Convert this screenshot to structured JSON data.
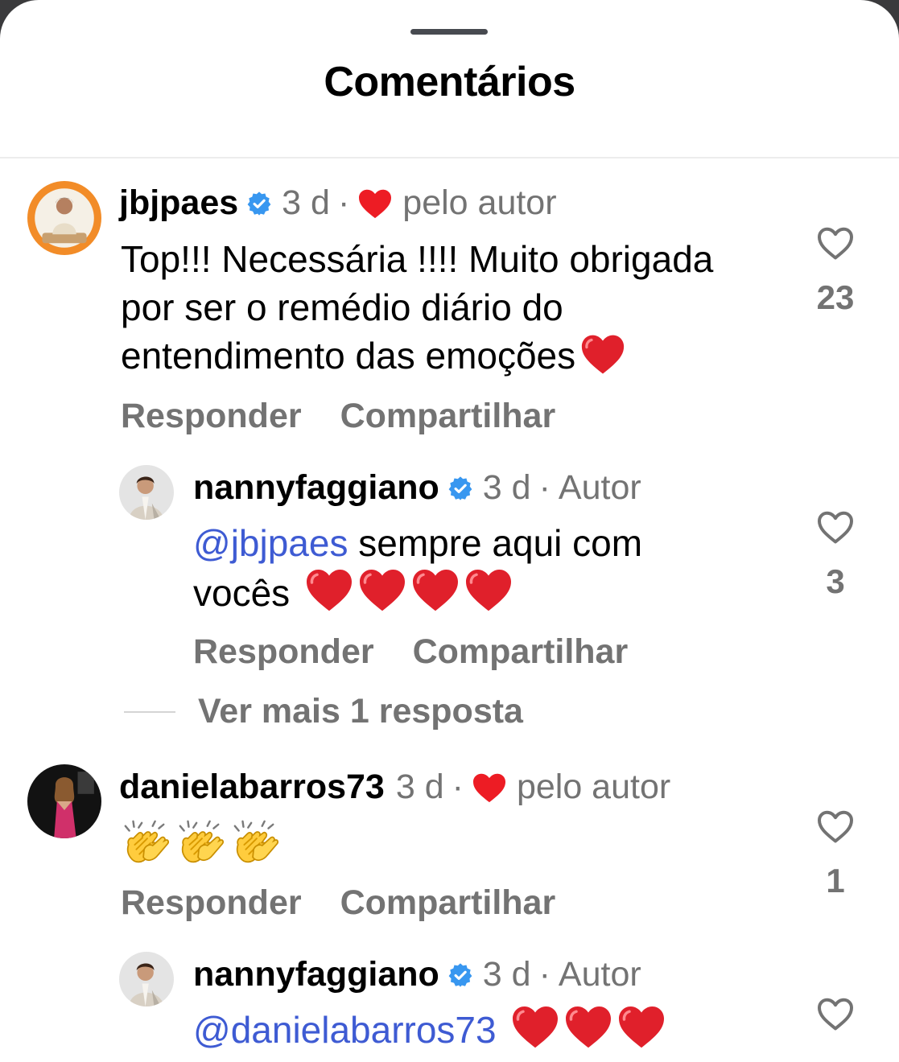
{
  "sheet": {
    "title": "Comentários"
  },
  "comments": [
    {
      "username": "jbjpaes",
      "time": "3 d",
      "separator": "·",
      "author_like": "pelo autor",
      "text": "Top!!! Necessária !!!! Muito obrigada por ser o remédio diário do entendimento das emoções",
      "likes": "23",
      "reply_label": "Responder",
      "share_label": "Compartilhar",
      "reply": {
        "username": "nannyfaggiano",
        "time": "3 d",
        "separator": "·",
        "badge": "Autor",
        "mention": "@jbjpaes",
        "text": "sempre aqui com vocês",
        "likes": "3",
        "reply_label": "Responder",
        "share_label": "Compartilhar"
      },
      "more_replies": "Ver mais 1 resposta"
    },
    {
      "username": "danielabarros73",
      "time": "3 d",
      "separator": "·",
      "author_like": "pelo autor",
      "likes": "1",
      "reply_label": "Responder",
      "share_label": "Compartilhar",
      "reply": {
        "username": "nannyfaggiano",
        "time": "3 d",
        "separator": "·",
        "badge": "Autor",
        "mention": "@danielabarros73"
      }
    }
  ],
  "colors": {
    "verified": "#3897f0",
    "heart": "#ed1c24",
    "mention": "#3e5bd3",
    "secondary_text": "#737373"
  },
  "icons": [
    "verified-badge-icon",
    "heart-icon",
    "heart-outline-icon",
    "red-heart-emoji",
    "clapping-hands-emoji"
  ]
}
